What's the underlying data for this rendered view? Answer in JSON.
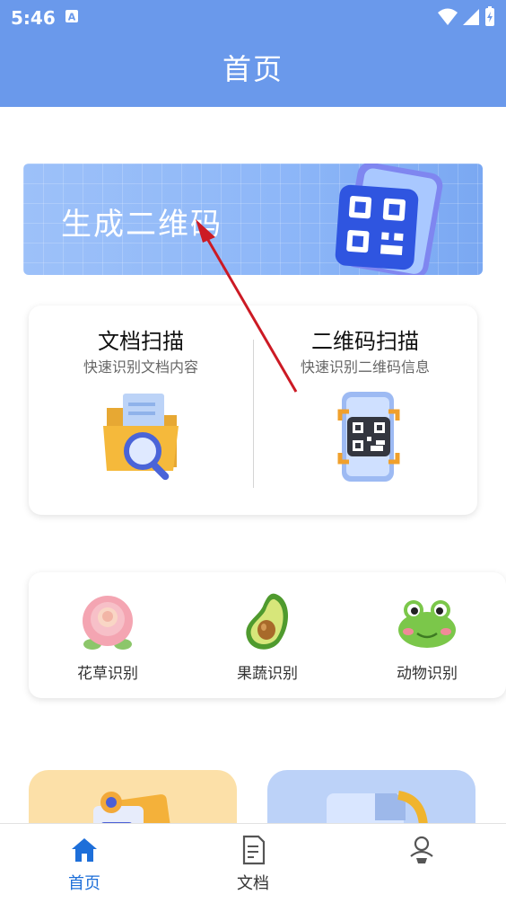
{
  "status_bar": {
    "time": "5:46",
    "notification_icon": "a-icon",
    "signal_icons": [
      "wifi-icon",
      "cellular-icon",
      "battery-icon"
    ]
  },
  "app_bar": {
    "title": "首页",
    "background": "#6a99eb"
  },
  "banner": {
    "title": "生成二维码",
    "illustration": "qr-phone-icon"
  },
  "scan_card": {
    "items": [
      {
        "title": "文档扫描",
        "subtitle": "快速识别文档内容",
        "icon": "folder-search-icon"
      },
      {
        "title": "二维码扫描",
        "subtitle": "快速识别二维码信息",
        "icon": "phone-qr-scan-icon"
      }
    ]
  },
  "identify_card": {
    "items": [
      {
        "label": "花草识别",
        "icon": "rose-icon"
      },
      {
        "label": "果蔬识别",
        "icon": "avocado-icon"
      },
      {
        "label": "动物识别",
        "icon": "frog-icon"
      }
    ]
  },
  "tab_bar": {
    "tabs": [
      {
        "label": "首页",
        "icon": "home-icon",
        "active": true
      },
      {
        "label": "文档",
        "icon": "document-icon",
        "active": false
      },
      {
        "label": "",
        "icon": "user-icon",
        "active": false
      }
    ],
    "active_color": "#1e6fd9",
    "inactive_color": "#555555"
  },
  "annotation": {
    "type": "arrow",
    "color": "#cc1a24"
  }
}
